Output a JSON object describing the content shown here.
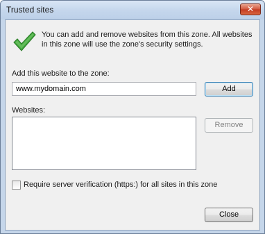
{
  "window": {
    "title": "Trusted sites",
    "close_glyph": "✕"
  },
  "info": {
    "icon": "checkmark-icon",
    "icon_color": "#3fa53b",
    "text": "You can add and remove websites from this zone. All websites in this zone will use the zone's security settings."
  },
  "add": {
    "label": "Add this website to the zone:",
    "value": "www.mydomain.com",
    "button": "Add"
  },
  "websites": {
    "label": "Websites:",
    "items": [],
    "remove_button": "Remove"
  },
  "https": {
    "checked": false,
    "label": "Require server verification (https:) for all sites in this zone"
  },
  "footer": {
    "close_button": "Close"
  }
}
